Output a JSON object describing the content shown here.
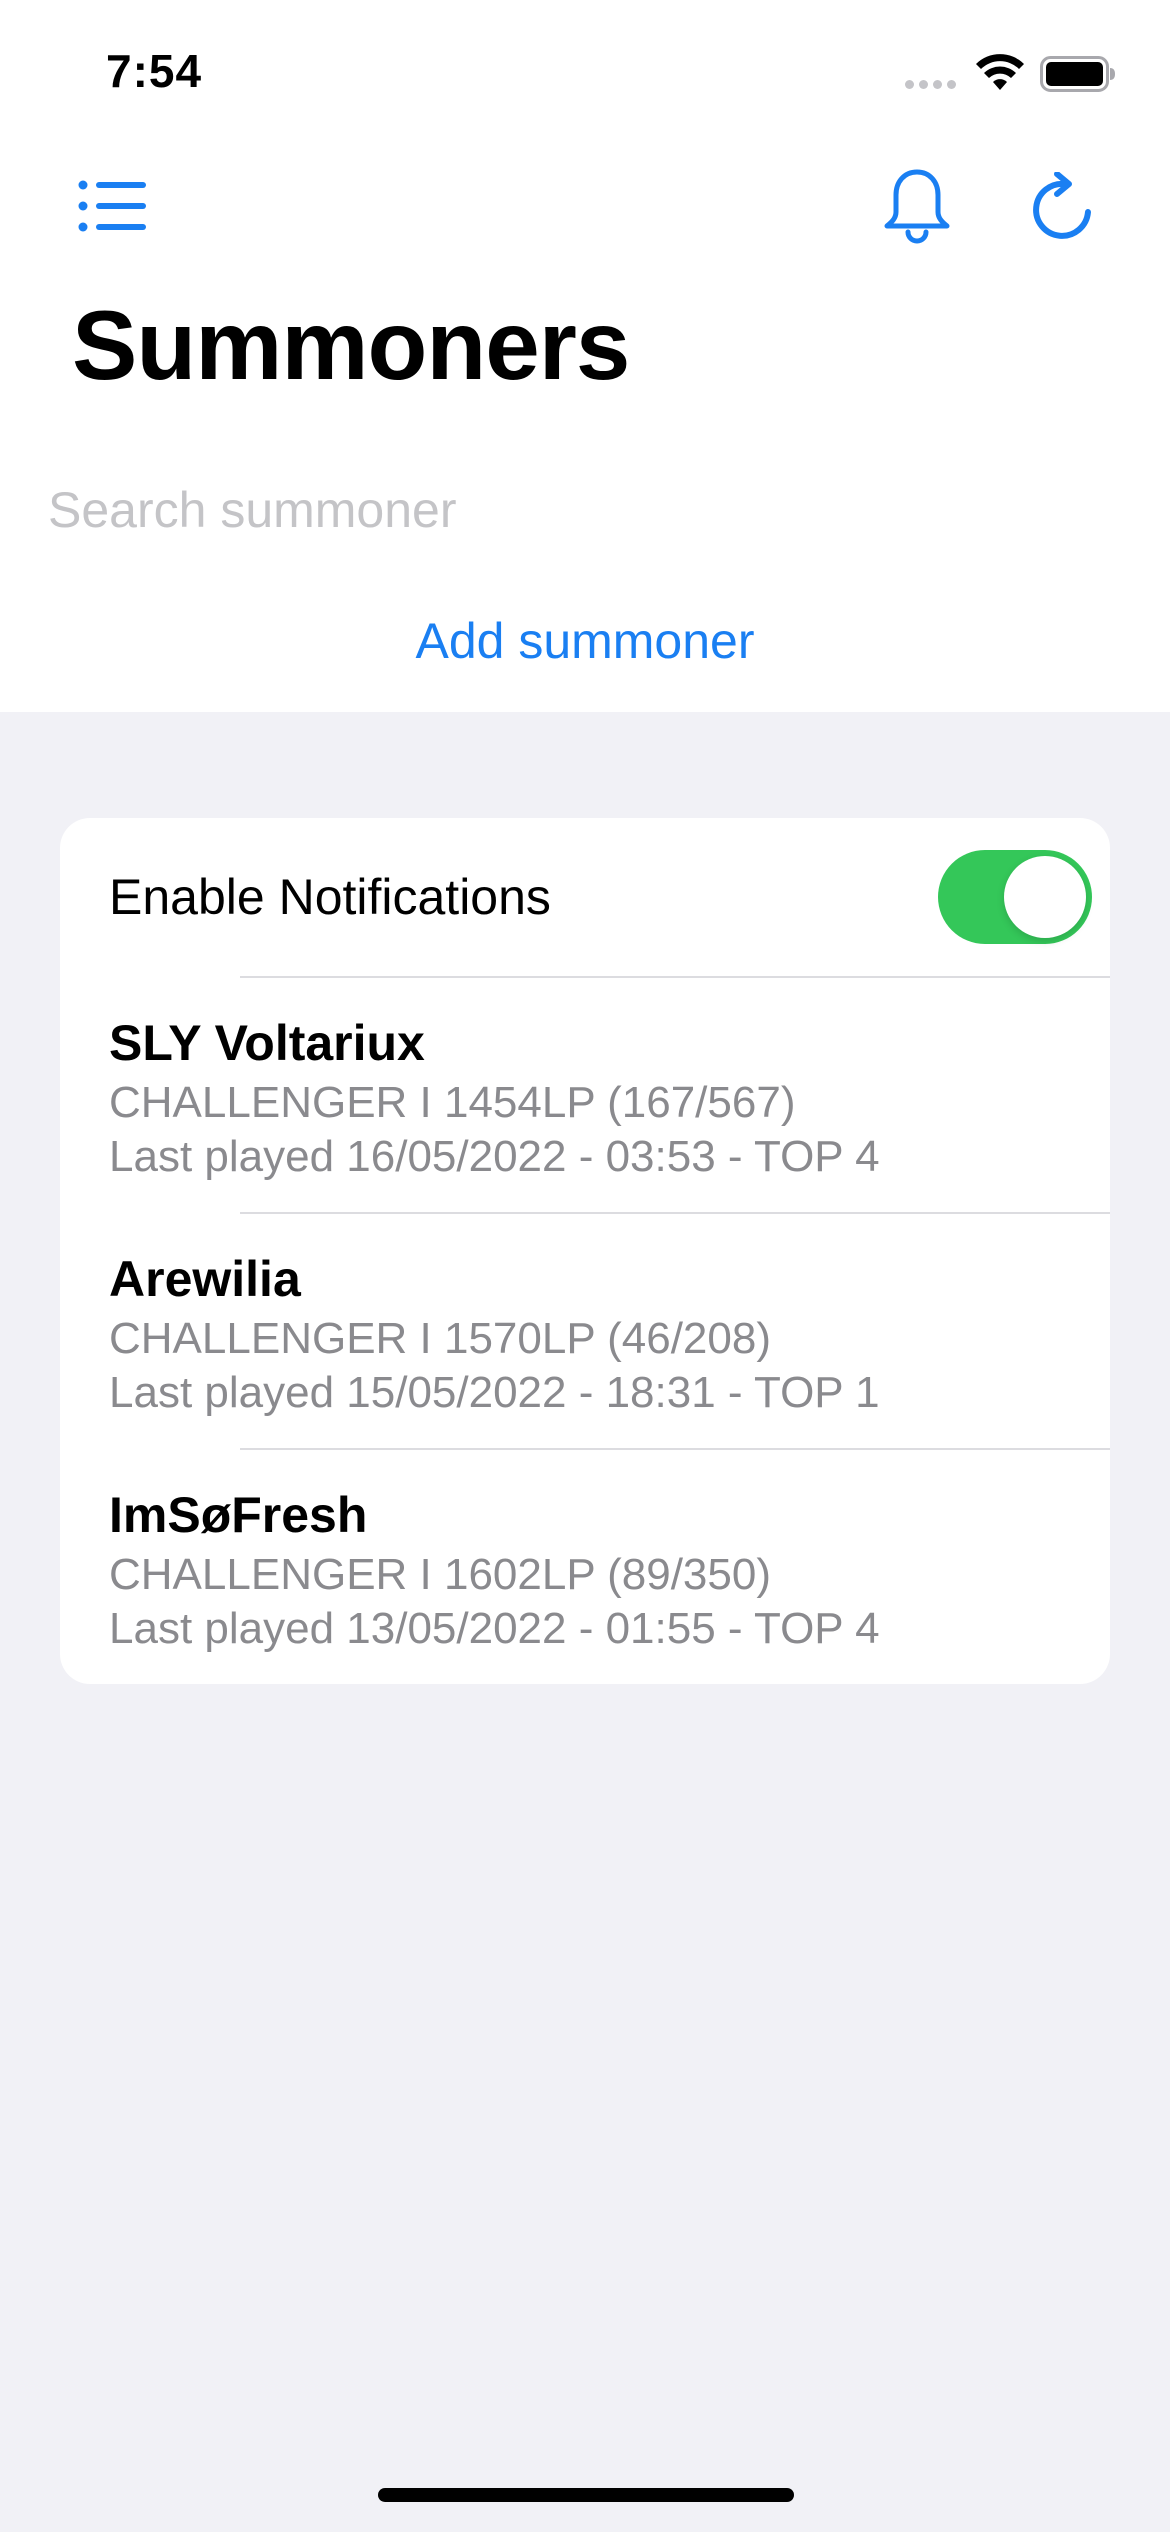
{
  "status_bar": {
    "time": "7:54"
  },
  "nav": {
    "left_icon": "list-icon",
    "right_icons": [
      "bell-icon",
      "refresh-icon"
    ],
    "accent_color": "#1a7ff2"
  },
  "header": {
    "title": "Summoners"
  },
  "search": {
    "placeholder": "Search summoner",
    "value": ""
  },
  "actions": {
    "add_label": "Add summoner"
  },
  "notifications": {
    "label": "Enable Notifications",
    "enabled": true,
    "toggle_color": "#34c759"
  },
  "summoners": [
    {
      "name": "SLY Voltariux",
      "rank": "CHALLENGER I 1454LP (167/567)",
      "last_played": "Last played 16/05/2022 - 03:53 - TOP 4"
    },
    {
      "name": "Arewilia",
      "rank": "CHALLENGER I 1570LP (46/208)",
      "last_played": "Last played 15/05/2022 - 18:31 - TOP 1"
    },
    {
      "name": "ImSøFresh",
      "rank": "CHALLENGER I 1602LP (89/350)",
      "last_played": "Last played 13/05/2022 - 01:55 - TOP 4"
    }
  ]
}
